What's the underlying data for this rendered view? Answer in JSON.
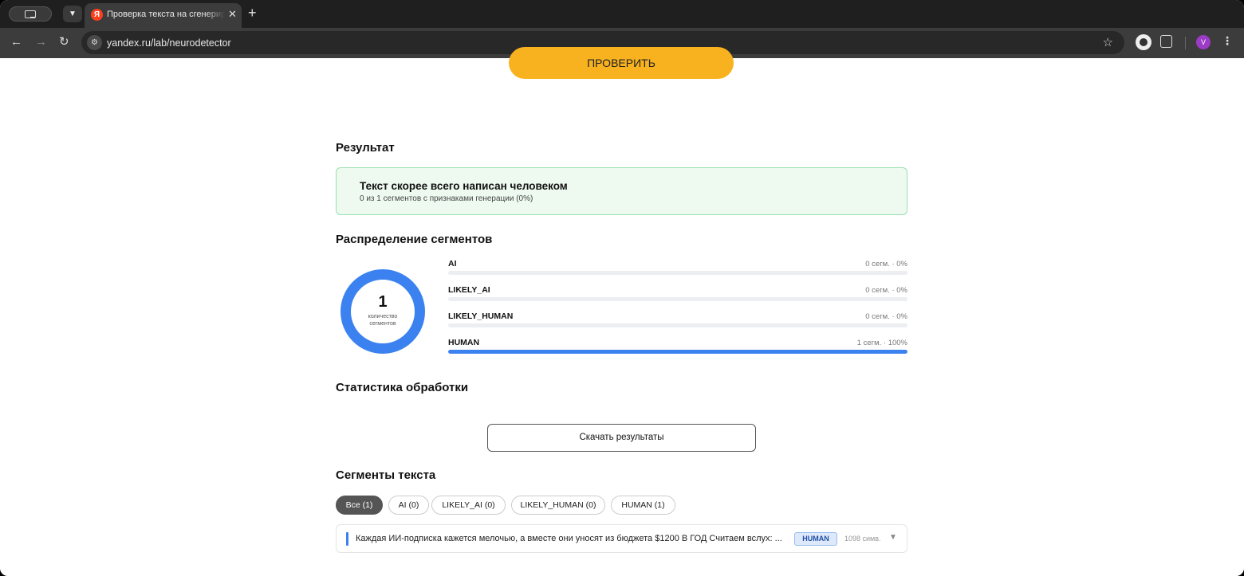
{
  "browser": {
    "tab_title": "Проверка текста на сгенерированность",
    "tab_favicon": "Я",
    "url": "yandex.ru/lab/neurodetector",
    "avatar_letter": "V",
    "accent_colors": {
      "yandex_red": "#fc3f1d",
      "profile": "#9c3bc6"
    }
  },
  "page": {
    "check_button": "ПРОВЕРИТЬ",
    "result_heading": "Результат",
    "result_title": "Текст скорее всего написан человеком",
    "result_subtitle": "0 из 1 сегментов с признаками генерации (0%)",
    "distribution_heading": "Распределение сегментов",
    "donut": {
      "total": "1",
      "label_line1": "количество",
      "label_line2": "сегментов",
      "color": "#3b82f0"
    },
    "bars": [
      {
        "name": "AI",
        "value": "0 сегм. · 0%",
        "fraction": 0
      },
      {
        "name": "LIKELY_AI",
        "value": "0 сегм. · 0%",
        "fraction": 0
      },
      {
        "name": "LIKELY_HUMAN",
        "value": "0 сегм. · 0%",
        "fraction": 0
      },
      {
        "name": "HUMAN",
        "value": "1 сегм. · 100%",
        "fraction": 1
      }
    ],
    "stats_heading": "Статистика обработки",
    "download_button": "Скачать результаты",
    "segments_heading": "Сегменты текста",
    "filters": [
      {
        "label": "Все (1)",
        "active": true
      },
      {
        "label": "AI (0)",
        "active": false
      },
      {
        "label": "LIKELY_AI (0)",
        "active": false
      },
      {
        "label": "LIKELY_HUMAN (0)",
        "active": false
      },
      {
        "label": "HUMAN (1)",
        "active": false
      }
    ],
    "segment": {
      "text": "Каждая ИИ-подписка кажется мелочью, а вместе они уносят из бюджета $1200 В ГОД Считаем вслух: ...",
      "badge": "HUMAN",
      "length": "1098 симв.",
      "caret": "▼"
    }
  }
}
